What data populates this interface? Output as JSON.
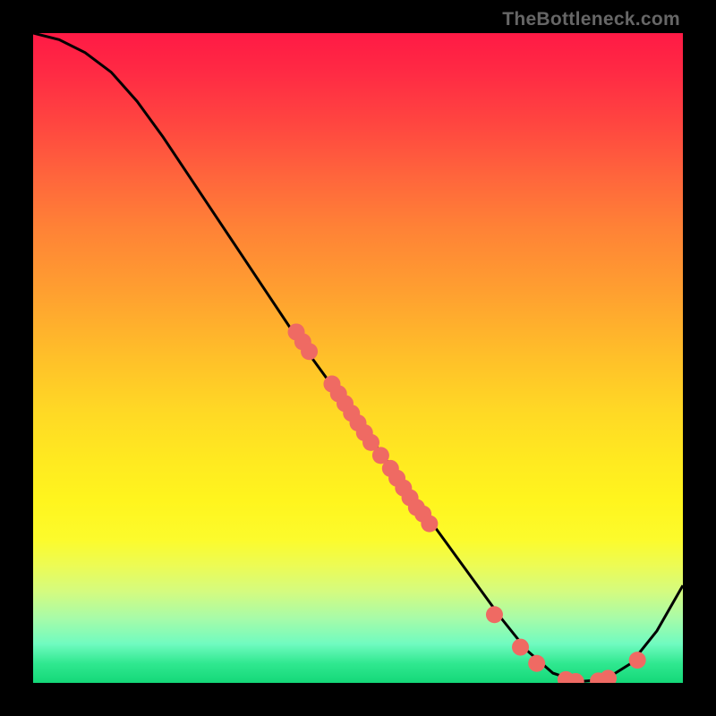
{
  "watermark": "TheBottleneck.com",
  "chart_data": {
    "type": "line",
    "title": "",
    "xlabel": "",
    "ylabel": "",
    "xlim": [
      0,
      100
    ],
    "ylim": [
      0,
      100
    ],
    "series": [
      {
        "name": "curve",
        "color": "#000000",
        "x": [
          0,
          4,
          8,
          12,
          16,
          20,
          24,
          28,
          32,
          36,
          40,
          44,
          48,
          52,
          56,
          60,
          64,
          68,
          72,
          76,
          80,
          84,
          88,
          92,
          96,
          100
        ],
        "y": [
          100,
          99,
          97,
          94,
          89.5,
          84,
          78,
          72,
          66,
          60,
          54,
          48.5,
          43,
          37.5,
          32,
          26.5,
          21,
          15.5,
          10,
          5,
          1.5,
          0.2,
          0.5,
          3,
          8,
          15
        ]
      }
    ],
    "scatter": [
      {
        "x": 40.5,
        "y": 54
      },
      {
        "x": 41.5,
        "y": 52.5
      },
      {
        "x": 42.5,
        "y": 51
      },
      {
        "x": 46,
        "y": 46
      },
      {
        "x": 47,
        "y": 44.5
      },
      {
        "x": 48,
        "y": 43
      },
      {
        "x": 49,
        "y": 41.5
      },
      {
        "x": 50,
        "y": 40
      },
      {
        "x": 51,
        "y": 38.5
      },
      {
        "x": 52,
        "y": 37
      },
      {
        "x": 53.5,
        "y": 35
      },
      {
        "x": 55,
        "y": 33
      },
      {
        "x": 56,
        "y": 31.5
      },
      {
        "x": 57,
        "y": 30
      },
      {
        "x": 58,
        "y": 28.5
      },
      {
        "x": 59,
        "y": 27
      },
      {
        "x": 60,
        "y": 26
      },
      {
        "x": 61,
        "y": 24.5
      },
      {
        "x": 71,
        "y": 10.5
      },
      {
        "x": 75,
        "y": 5.5
      },
      {
        "x": 77.5,
        "y": 3
      },
      {
        "x": 82,
        "y": 0.5
      },
      {
        "x": 83.5,
        "y": 0.2
      },
      {
        "x": 87,
        "y": 0.3
      },
      {
        "x": 88.5,
        "y": 0.7
      },
      {
        "x": 93,
        "y": 3.5
      }
    ],
    "scatter_color": "#ef6a63",
    "scatter_radius": 9.5
  }
}
